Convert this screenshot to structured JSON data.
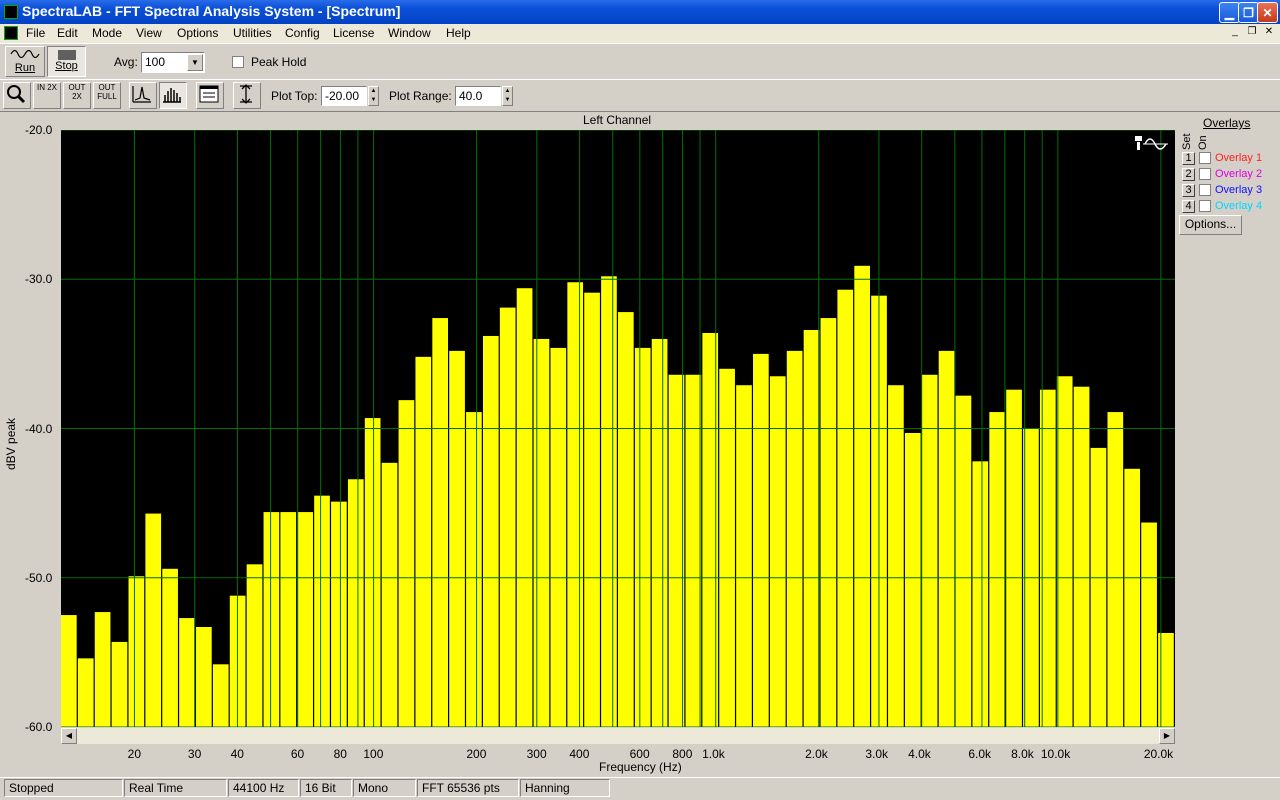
{
  "window": {
    "title": "SpectraLAB - FFT Spectral Analysis System - [Spectrum]"
  },
  "menu": [
    "File",
    "Edit",
    "Mode",
    "View",
    "Options",
    "Utilities",
    "Config",
    "License",
    "Window",
    "Help"
  ],
  "toolbar": {
    "run_label": "Run",
    "stop_label": "Stop",
    "avg_label": "Avg:",
    "avg_value": "100",
    "peak_hold_label": "Peak Hold",
    "zoom_in_label": "IN 2X",
    "zoom_out_label": "OUT 2X",
    "zoom_full_label": "OUT FULL",
    "plot_top_label": "Plot Top:",
    "plot_top_value": "-20.00",
    "plot_range_label": "Plot Range:",
    "plot_range_value": "40.0"
  },
  "overlays": {
    "header": "Overlays",
    "set_label": "Set",
    "on_label": "On",
    "items": [
      {
        "num": "1",
        "label": "Overlay 1",
        "color": "#ff2020"
      },
      {
        "num": "2",
        "label": "Overlay 2",
        "color": "#e000e0"
      },
      {
        "num": "3",
        "label": "Overlay 3",
        "color": "#1010ff"
      },
      {
        "num": "4",
        "label": "Overlay 4",
        "color": "#00d8ff"
      }
    ],
    "options_label": "Options..."
  },
  "status": [
    "Stopped",
    "Real Time",
    "44100 Hz",
    "16 Bit",
    "Mono",
    "FFT 65536 pts",
    "Hanning"
  ],
  "colors": {
    "bar": "#ffff00",
    "grid": "#007000",
    "plot_bg": "#000000",
    "titlebar": "#0a50d8"
  },
  "chart_data": {
    "type": "bar",
    "title": "Left Channel",
    "xlabel": "Frequency (Hz)",
    "ylabel": "dBV peak",
    "xscale": "log",
    "xlim": [
      12.2,
      22000
    ],
    "ylim": [
      -60,
      -20
    ],
    "yticks": [
      -20,
      -30,
      -40,
      -50,
      -60
    ],
    "ytick_labels": [
      "-20.0",
      "-30.0",
      "-40.0",
      "-50.0",
      "-60.0"
    ],
    "xticks": [
      20,
      30,
      40,
      60,
      80,
      100,
      200,
      300,
      400,
      600,
      800,
      1000,
      2000,
      3000,
      4000,
      6000,
      8000,
      10000,
      20000
    ],
    "xtick_labels": [
      "20",
      "30",
      "40",
      "60",
      "80",
      "100",
      "200",
      "300",
      "400",
      "600",
      "800",
      "1.0k",
      "2.0k",
      "3.0k",
      "4.0k",
      "6.0k",
      "8.0k",
      "10.0k",
      "20.0k"
    ],
    "grid": true,
    "minor_grid_x": [
      50,
      70,
      90,
      500,
      700,
      900,
      5000,
      7000,
      9000
    ],
    "values": [
      -52.5,
      -55.4,
      -52.3,
      -54.3,
      -49.9,
      -45.7,
      -49.4,
      -52.7,
      -53.3,
      -55.8,
      -51.2,
      -49.1,
      -45.6,
      -45.6,
      -45.6,
      -44.5,
      -44.9,
      -43.4,
      -39.3,
      -42.3,
      -38.1,
      -35.2,
      -32.6,
      -34.8,
      -38.9,
      -33.8,
      -31.9,
      -30.6,
      -34.0,
      -34.6,
      -30.2,
      -30.9,
      -29.8,
      -32.2,
      -34.6,
      -34.0,
      -36.4,
      -36.4,
      -33.6,
      -36.0,
      -37.1,
      -35.0,
      -36.5,
      -34.8,
      -33.4,
      -32.6,
      -30.7,
      -29.1,
      -31.1,
      -37.1,
      -40.3,
      -36.4,
      -34.8,
      -37.8,
      -42.2,
      -38.9,
      -37.4,
      -40.0,
      -37.4,
      -36.5,
      -37.2,
      -41.3,
      -38.9,
      -42.7,
      -46.3,
      -53.7
    ]
  }
}
